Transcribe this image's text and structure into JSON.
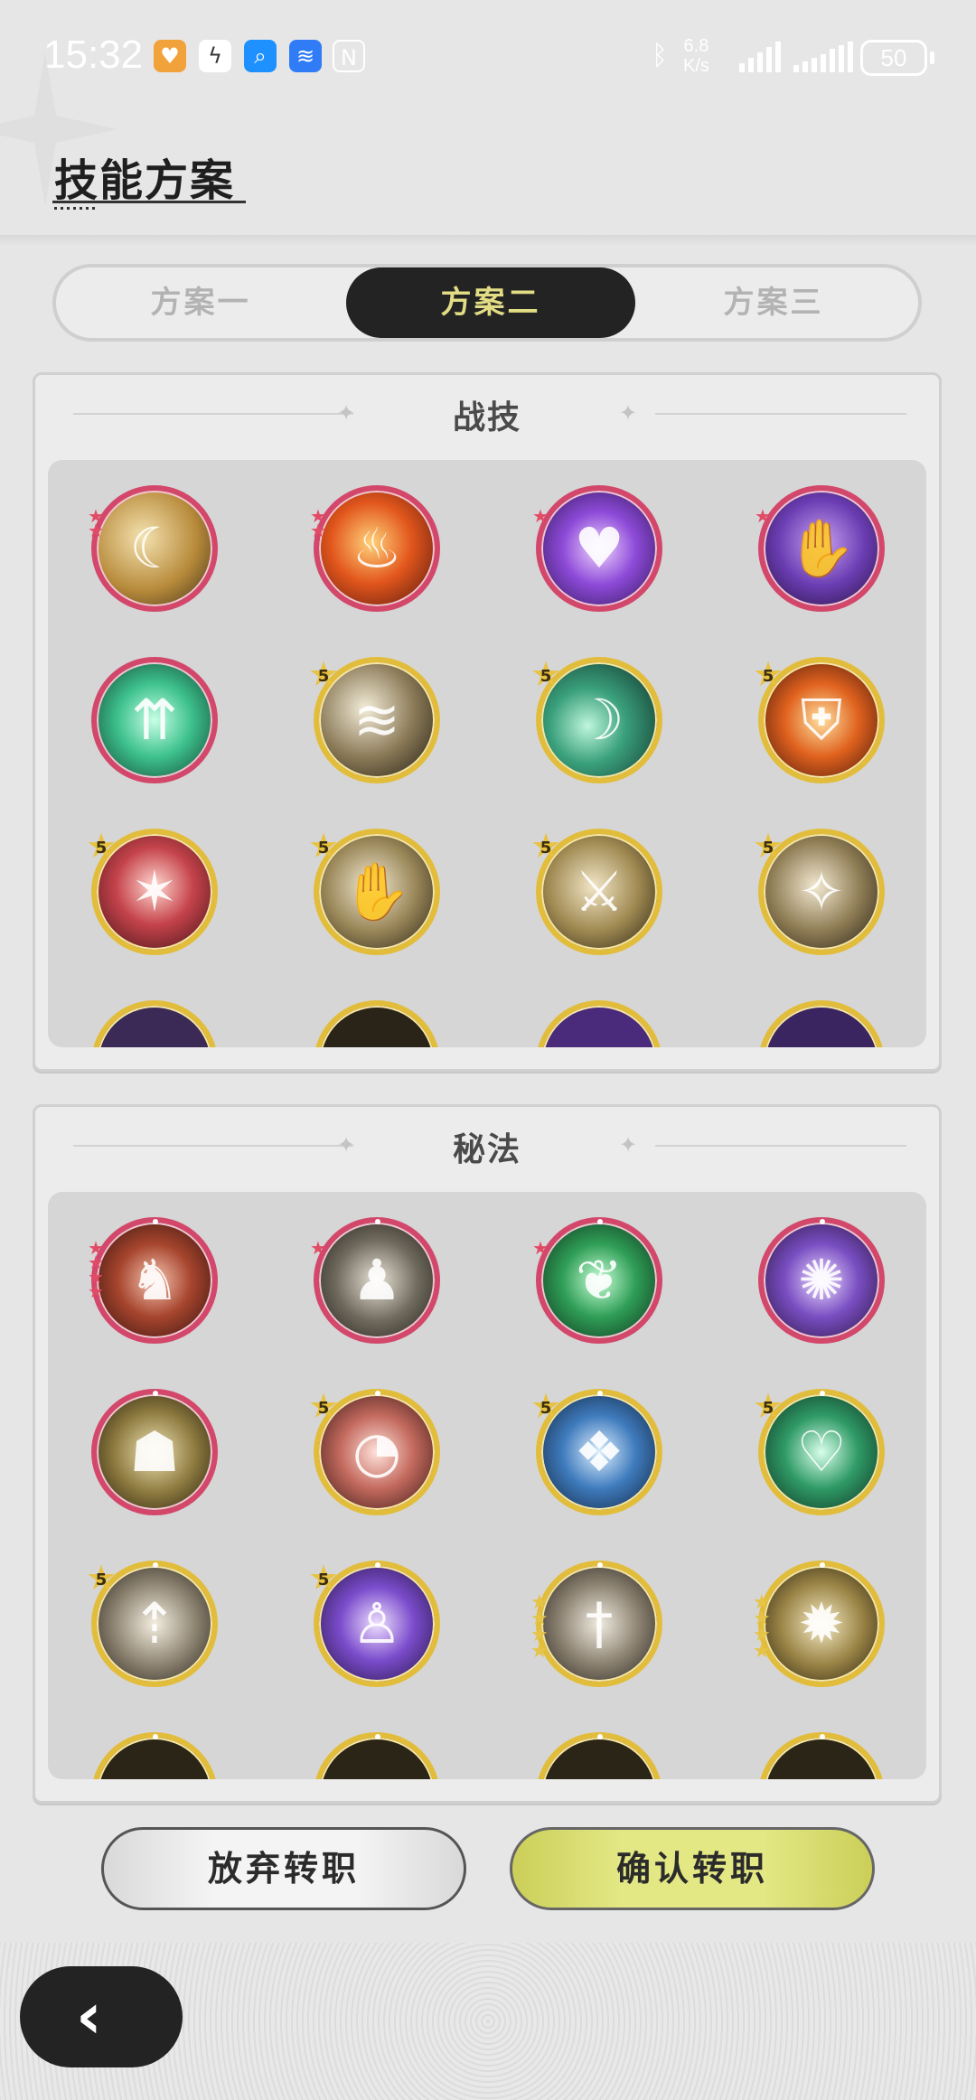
{
  "status_bar": {
    "time": "15:32",
    "net_speed_value": "6.8",
    "net_speed_unit": "K/s",
    "battery": "50",
    "icons": [
      "app-heart-icon",
      "app-link-icon",
      "search-app-icon",
      "wifi-app-icon",
      "nfc-icon",
      "bluetooth-icon",
      "signal-icon",
      "signal-icon-2"
    ]
  },
  "page_title": "技能方案",
  "tabs": [
    {
      "label": "方案一",
      "active": false
    },
    {
      "label": "方案二",
      "active": true
    },
    {
      "label": "方案三",
      "active": false
    }
  ],
  "sections": {
    "battle_skills": {
      "title": "战技",
      "rows": [
        [
          {
            "icon": "golden-slash-skill-icon",
            "frame": "red",
            "stars": 2
          },
          {
            "icon": "fire-vortex-skill-icon",
            "frame": "red",
            "stars": 2
          },
          {
            "icon": "purple-heart-skill-icon",
            "frame": "red",
            "stars": 1
          },
          {
            "icon": "purple-claw-skill-icon",
            "frame": "red",
            "stars": 1
          }
        ],
        [
          {
            "icon": "green-arrows-up-skill-icon",
            "frame": "red",
            "stars": 0
          },
          {
            "icon": "wind-slash-skill-icon",
            "frame": "gold",
            "badge": "5"
          },
          {
            "icon": "green-crescent-skill-icon",
            "frame": "gold",
            "badge": "5"
          },
          {
            "icon": "fire-shield-skill-icon",
            "frame": "gold",
            "badge": "5"
          }
        ],
        [
          {
            "icon": "red-burst-figure-skill-icon",
            "frame": "gold",
            "badge": "5"
          },
          {
            "icon": "grasping-hand-skill-icon",
            "frame": "gold",
            "badge": "5"
          },
          {
            "icon": "crescent-sword-skill-icon",
            "frame": "gold",
            "badge": "5"
          },
          {
            "icon": "leaping-figure-skill-icon",
            "frame": "gold",
            "badge": "5"
          }
        ]
      ]
    },
    "arcana": {
      "title": "秘法",
      "rows": [
        [
          {
            "icon": "red-warrior-arcana-icon",
            "frame": "red",
            "stars": 4
          },
          {
            "icon": "dodging-figure-arcana-icon",
            "frame": "red",
            "stars": 1
          },
          {
            "icon": "green-leaf-arcana-icon",
            "frame": "red",
            "stars": 1
          },
          {
            "icon": "purple-spirit-arcana-icon",
            "frame": "red",
            "stars": 0
          }
        ],
        [
          {
            "icon": "golden-group-arcana-icon",
            "frame": "red",
            "stars": 0
          },
          {
            "icon": "red-wave-arcana-icon",
            "frame": "gold",
            "badge": "5"
          },
          {
            "icon": "blue-crystal-arcana-icon",
            "frame": "gold",
            "badge": "5"
          },
          {
            "icon": "green-heart-heal-arcana-icon",
            "frame": "gold",
            "badge": "5"
          }
        ],
        [
          {
            "icon": "sword-up-arcana-icon",
            "frame": "gold",
            "badge": "5"
          },
          {
            "icon": "purple-figure-arcana-icon",
            "frame": "gold",
            "badge": "5"
          },
          {
            "icon": "dagger-down-arcana-icon",
            "frame": "gold",
            "goldstars": 4
          },
          {
            "icon": "golden-swirl-arcana-icon",
            "frame": "gold",
            "goldstars": 4
          }
        ]
      ]
    }
  },
  "buttons": {
    "abandon": "放弃转职",
    "confirm": "确认转职"
  },
  "colors": {
    "tab_active_bg": "#232323",
    "tab_active_text": "#e2dc84",
    "frame_red": "#d3476b",
    "frame_gold": "#e2bd3c",
    "confirm_button": "#e3e784"
  }
}
